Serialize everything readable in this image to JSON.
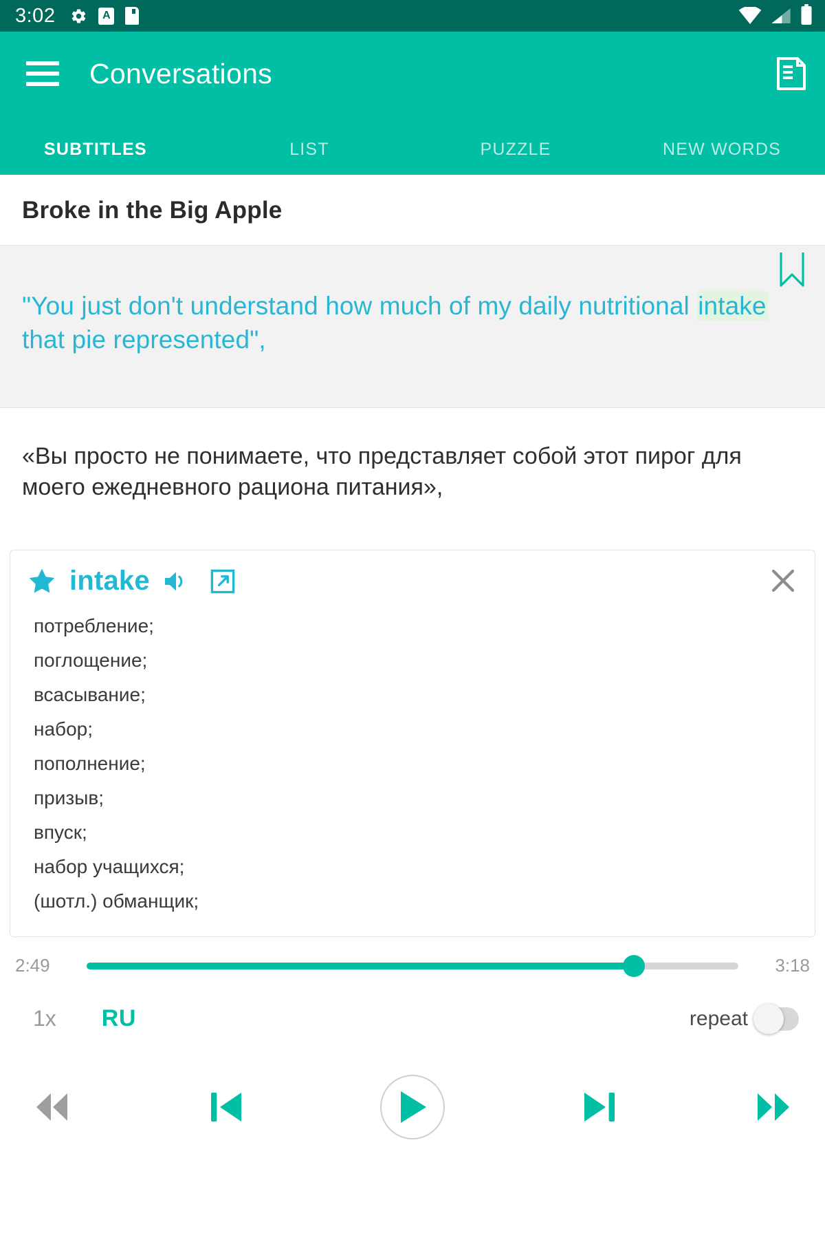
{
  "status_bar": {
    "time": "3:02",
    "left_icons": [
      "settings-gear-icon",
      "a-badge-icon",
      "sd-card-icon"
    ],
    "right_icons": [
      "wifi-icon",
      "cellular-signal-icon",
      "battery-icon"
    ]
  },
  "app_bar": {
    "menu_icon": "hamburger-menu-icon",
    "title": "Conversations",
    "action_icon": "note-list-icon"
  },
  "tabs": [
    {
      "label": "SUBTITLES",
      "active": true
    },
    {
      "label": "LIST",
      "active": false
    },
    {
      "label": "PUZZLE",
      "active": false
    },
    {
      "label": "NEW WORDS",
      "active": false
    }
  ],
  "episode": {
    "title": "Broke in the Big Apple"
  },
  "subtitle": {
    "bookmark_icon": "bookmark-icon",
    "english_before": "\"You just don't understand how much of my daily nutritional ",
    "english_highlight": "intake",
    "english_after": " that pie represented\",",
    "russian": "«Вы просто не понимаете, что представляет собой этот пирог для моего ежедневного рациона питания»,"
  },
  "dictionary_card": {
    "star_icon": "star-filled-icon",
    "word": "intake",
    "speaker_icon": "speaker-icon",
    "external_link_icon": "external-link-icon",
    "close_icon": "close-icon",
    "definitions": [
      "потребление;",
      "поглощение;",
      "всасывание;",
      "набор;",
      "пополнение;",
      "призыв;",
      "впуск;",
      "набор учащихся;",
      "(шотл.) обманщик;"
    ]
  },
  "player": {
    "current_time": "2:49",
    "total_time": "3:18",
    "progress_percent": 84,
    "speed_label": "1x",
    "language_label": "RU",
    "repeat_label": "repeat",
    "repeat_on": false,
    "controls": [
      "rewind-icon",
      "previous-subtitle-icon",
      "play-icon",
      "next-subtitle-icon",
      "fast-forward-icon"
    ]
  },
  "colors": {
    "primary_teal": "#00BFA5",
    "status_bar_dark": "#00695C",
    "subtitle_cyan": "#29B6D4",
    "word_cyan": "#22B8D4",
    "highlight_green": "#e3f5e0",
    "disabled_gray": "#9a9a9a"
  }
}
